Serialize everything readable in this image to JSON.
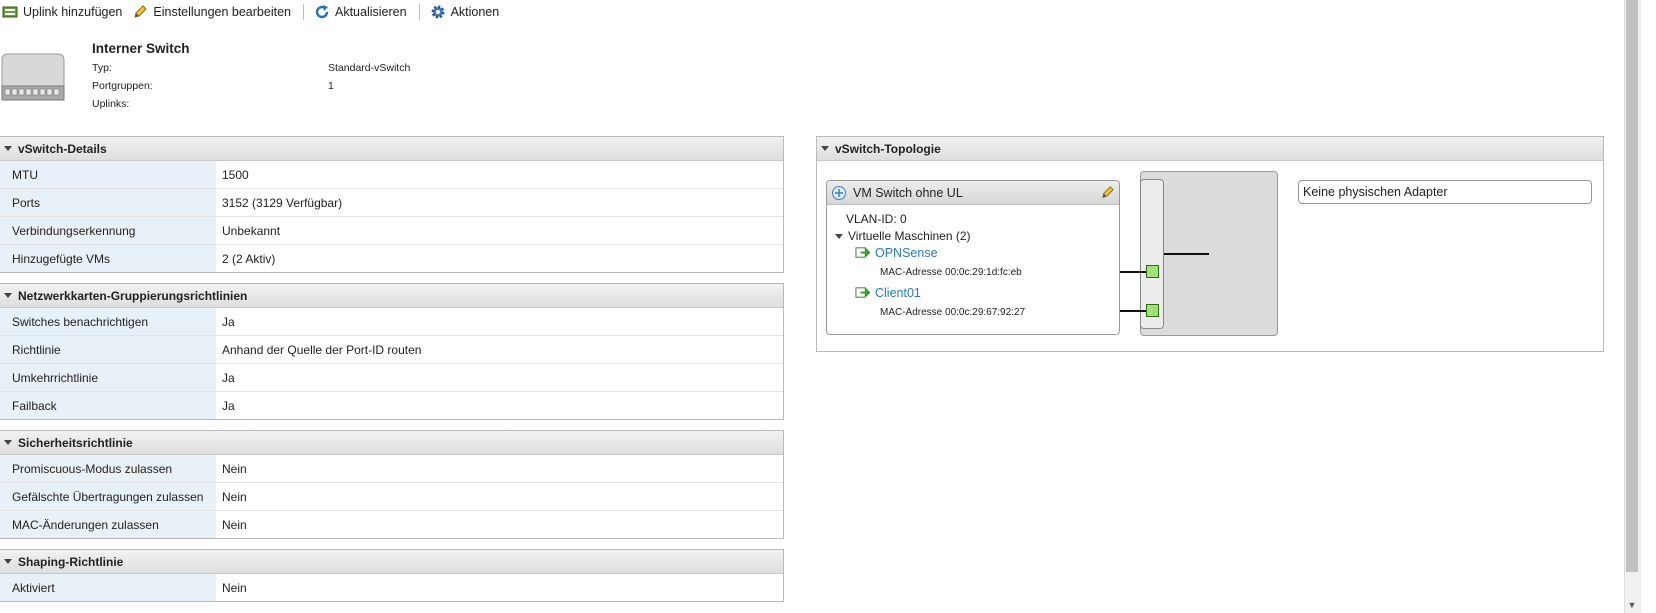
{
  "toolbar": {
    "add_uplink": "Uplink hinzufügen",
    "edit_settings": "Einstellungen bearbeiten",
    "refresh": "Aktualisieren",
    "actions": "Aktionen"
  },
  "header": {
    "title": "Interner Switch",
    "rows": [
      {
        "label": "Typ:",
        "value": "Standard-vSwitch"
      },
      {
        "label": "Portgruppen:",
        "value": "1"
      },
      {
        "label": "Uplinks:",
        "value": ""
      }
    ]
  },
  "details": {
    "title": "vSwitch-Details",
    "rows": [
      {
        "label": "MTU",
        "value": "1500"
      },
      {
        "label": "Ports",
        "value": "3152 (3129 Verfügbar)"
      },
      {
        "label": "Verbindungserkennung",
        "value": "Unbekannt"
      },
      {
        "label": "Hinzugefügte VMs",
        "value": "2 (2 Aktiv)"
      }
    ]
  },
  "teaming": {
    "title": "Netzwerkkarten-Gruppierungsrichtlinien",
    "rows": [
      {
        "label": "Switches benachrichtigen",
        "value": "Ja"
      },
      {
        "label": "Richtlinie",
        "value": "Anhand der Quelle der Port-ID routen"
      },
      {
        "label": "Umkehrrichtlinie",
        "value": "Ja"
      },
      {
        "label": "Failback",
        "value": "Ja"
      }
    ]
  },
  "security": {
    "title": "Sicherheitsrichtlinie",
    "rows": [
      {
        "label": "Promiscuous-Modus zulassen",
        "value": "Nein"
      },
      {
        "label": "Gefälschte Übertragungen zulassen",
        "value": "Nein"
      },
      {
        "label": "MAC-Änderungen zulassen",
        "value": "Nein"
      }
    ]
  },
  "shaping": {
    "title": "Shaping-Richtlinie",
    "rows": [
      {
        "label": "Aktiviert",
        "value": "Nein"
      }
    ]
  },
  "topology": {
    "title": "vSwitch-Topologie",
    "portgroup_name": "VM Switch ohne UL",
    "vlan": "VLAN-ID: 0",
    "vms_label": "Virtuelle Maschinen (2)",
    "vms": [
      {
        "name": "OPNSense",
        "mac": "MAC-Adresse 00:0c:29:1d:fc:eb"
      },
      {
        "name": "Client01",
        "mac": "MAC-Adresse 00:0c:29:67:92:27"
      }
    ],
    "no_adapter": "Keine physischen Adapter"
  },
  "icons": [
    "uplink-add-icon",
    "pencil-icon",
    "refresh-icon",
    "gear-icon",
    "switch-device-icon",
    "portgroup-icon",
    "vm-icon"
  ],
  "colors": {
    "link": "#2a78c2",
    "key_bg": "#e8f0f8",
    "port_green": "#9fe07a"
  }
}
